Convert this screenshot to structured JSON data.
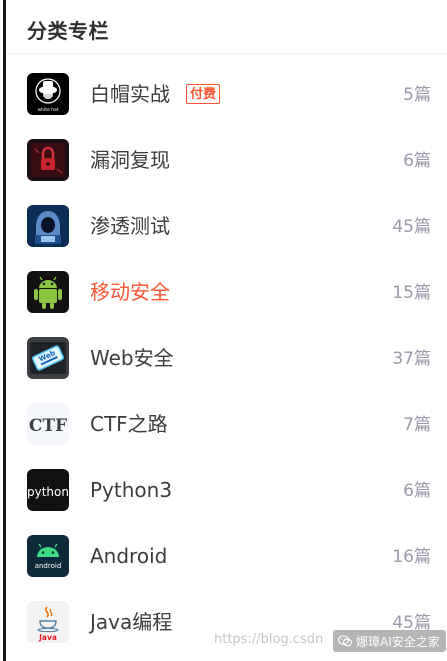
{
  "panel": {
    "title": "分类专栏"
  },
  "categories": [
    {
      "name": "白帽实战",
      "count": "5篇",
      "badge": "付费",
      "icon": "white-hat-icon",
      "thumb_text": "white hat",
      "active": false
    },
    {
      "name": "漏洞复现",
      "count": "6篇",
      "icon": "red-lock-icon",
      "active": false
    },
    {
      "name": "渗透测试",
      "count": "45篇",
      "icon": "hooded-hacker-icon",
      "active": false
    },
    {
      "name": "移动安全",
      "count": "15篇",
      "icon": "android-robot-icon",
      "active": true
    },
    {
      "name": "Web安全",
      "count": "37篇",
      "icon": "web-security-key-icon",
      "thumb_text": "Web",
      "active": false
    },
    {
      "name": "CTF之路",
      "count": "7篇",
      "icon": "ctf-logo-icon",
      "thumb_text": "CTF",
      "active": false
    },
    {
      "name": "Python3",
      "count": "6篇",
      "icon": "python-logo-icon",
      "thumb_text": "python",
      "active": false
    },
    {
      "name": "Android",
      "count": "16篇",
      "icon": "android-logo-icon",
      "thumb_text": "android",
      "active": false
    },
    {
      "name": "Java编程",
      "count": "45篇",
      "icon": "java-logo-icon",
      "thumb_text": "Java",
      "active": false
    }
  ],
  "watermark": {
    "url": "https://blog.csdn",
    "wechat_label": "娜璋AI安全之家"
  },
  "colors": {
    "accent": "#fc5531",
    "text": "#3d3d3d",
    "muted": "#999aaa"
  }
}
